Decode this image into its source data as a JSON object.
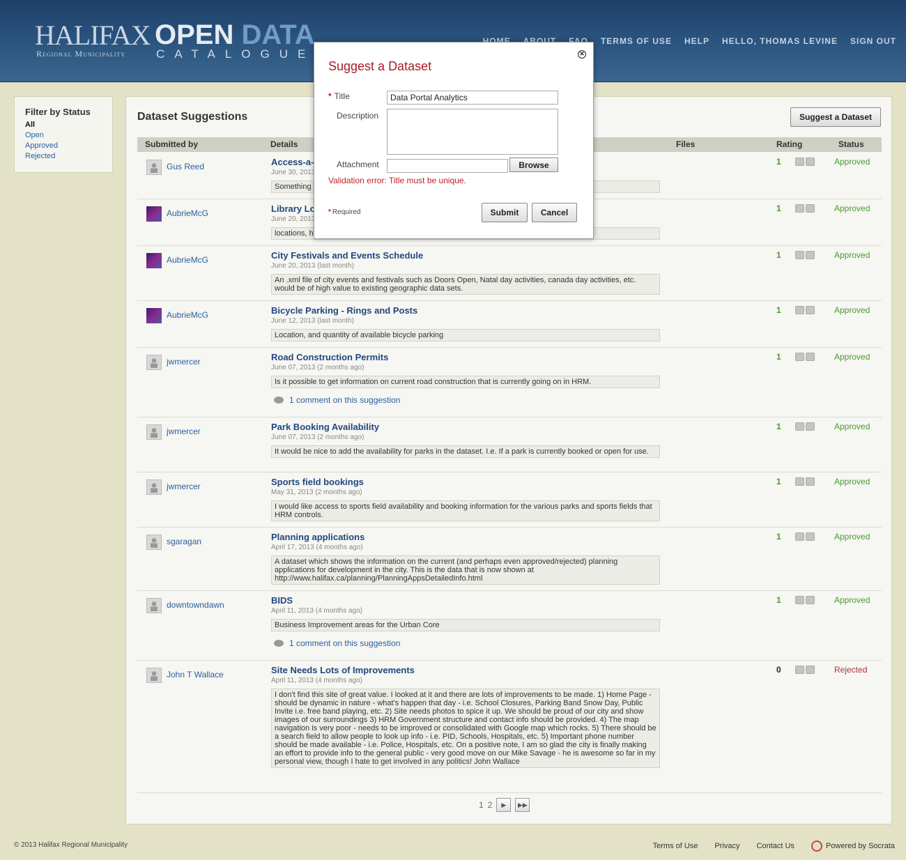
{
  "header": {
    "logo_halifax": "HALIFAX",
    "logo_halifax_sub": "Regional Municipality",
    "logo_open_1": "OPEN",
    "logo_open_2": "DATA",
    "logo_catalogue": "CATALOGUE",
    "nav": [
      "HOME",
      "ABOUT",
      "FAQ",
      "TERMS OF USE",
      "HELP",
      "HELLO, THOMAS LEVINE",
      "SIGN OUT"
    ]
  },
  "sidebar": {
    "title": "Filter by Status",
    "items": [
      "All",
      "Open",
      "Approved",
      "Rejected"
    ],
    "active": "All"
  },
  "main": {
    "title": "Dataset Suggestions",
    "suggest_button": "Suggest a Dataset",
    "columns": [
      "Submitted by",
      "Details",
      "Files",
      "Rating",
      "Status"
    ],
    "rows": [
      {
        "submitter": "Gus Reed",
        "title": "Access-a-Bus",
        "date": "June 30, 2013 (last month)",
        "desc": "Something",
        "rating": "1",
        "status": "Approved",
        "avatar": "default"
      },
      {
        "submitter": "AubrieMcG",
        "title": "Library Locations",
        "date": "June 20, 2013 (last month)",
        "desc": "locations, hours",
        "rating": "1",
        "status": "Approved",
        "avatar": "photo"
      },
      {
        "submitter": "AubrieMcG",
        "title": "City Festivals and Events Schedule",
        "date": "June 20, 2013 (last month)",
        "desc": "An .xml file of city events and festivals such as Doors Open, Natal day activities, canada day activities, etc. would be of high value to existing geographic data sets.",
        "rating": "1",
        "status": "Approved",
        "avatar": "photo"
      },
      {
        "submitter": "AubrieMcG",
        "title": "Bicycle Parking - Rings and Posts",
        "date": "June 12, 2013 (last month)",
        "desc": "Location, and quantity of available bicycle parking",
        "rating": "1",
        "status": "Approved",
        "avatar": "photo"
      },
      {
        "submitter": "jwmercer",
        "title": "Road Construction Permits",
        "date": "June 07, 2013 (2 months ago)",
        "desc": "Is it possible to get information on current road construction that is currently going on in HRM.",
        "comment": "1 comment on this suggestion",
        "rating": "1",
        "status": "Approved",
        "avatar": "default"
      },
      {
        "submitter": "jwmercer",
        "title": "Park Booking Availability",
        "date": "June 07, 2013 (2 months ago)",
        "desc": "It would be nice to add the availability for parks in the dataset. I.e. If a park is currently booked or open for use.",
        "rating": "1",
        "status": "Approved",
        "avatar": "default"
      },
      {
        "submitter": "jwmercer",
        "title": "Sports field bookings",
        "date": "May 31, 2013 (2 months ago)",
        "desc": "I would like access to sports field availability and booking information for the various parks and sports fields that HRM controls.",
        "rating": "1",
        "status": "Approved",
        "avatar": "default"
      },
      {
        "submitter": "sgaragan",
        "title": "Planning applications",
        "date": "April 17, 2013 (4 months ago)",
        "desc": "A dataset which shows the information on the current (and perhaps even approved/rejected) planning applications for development in the city. This is the data that is now shown at http://www.halifax.ca/planning/PlanningAppsDetailedInfo.html",
        "rating": "1",
        "status": "Approved",
        "avatar": "default"
      },
      {
        "submitter": "downtowndawn",
        "title": "BIDS",
        "date": "April 11, 2013 (4 months ago)",
        "desc": "Business Improvement areas for the Urban Core",
        "comment": "1 comment on this suggestion",
        "rating": "1",
        "status": "Approved",
        "avatar": "default"
      },
      {
        "submitter": "John T Wallace",
        "title": "Site Needs Lots of Improvements",
        "date": "April 11, 2013 (4 months ago)",
        "desc": "I don't find this site of great value. I looked at it and there are lots of improvements to be made. 1) Home Page - should be dynamic in nature - what's happen that day - i.e. School Closures, Parking Band Snow Day, Public Invite i.e. free band playing, etc. 2) Site needs photos to spice it up. We should be proud of our city and show images of our surroundings 3) HRM Government structure and contact info should be provided. 4) The map navigation is very poor - needs to be improved or consolidated with Google map which rocks. 5) There should be a search field to allow people to look up info - i.e. PID, Schools, Hospitals, etc. 5) Important phone number should be made available - i.e. Police, Hospitals, etc. On a positive note, I am so glad the city is finally making an effort to provide info to the general public - very good move on our Mike Savage - he is awesome so far in my personal view, though I hate to get involved in any politics! John Wallace",
        "rating": "0",
        "status": "Rejected",
        "avatar": "default"
      }
    ],
    "pager": {
      "pages": [
        "1",
        "2"
      ],
      "next": "▶",
      "last": "▶▶"
    }
  },
  "modal": {
    "title": "Suggest a Dataset",
    "title_label": "Title",
    "title_value": "Data Portal Analytics",
    "description_label": "Description",
    "attachment_label": "Attachment",
    "browse": "Browse",
    "error": "Validation error: Title must be unique.",
    "required": "Required",
    "submit": "Submit",
    "cancel": "Cancel",
    "close": "✕"
  },
  "footer": {
    "copyright": "© 2013 Halifax Regional Municipality",
    "links": [
      "Terms of Use",
      "Privacy",
      "Contact Us"
    ],
    "powered": "Powered by Socrata"
  }
}
